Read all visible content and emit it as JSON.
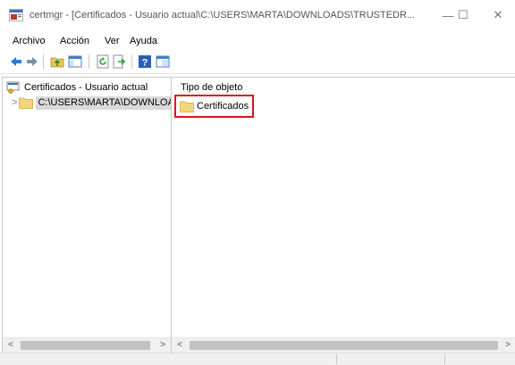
{
  "window": {
    "title": "certmgr - [Certificados - Usuario actual\\C:\\USERS\\MARTA\\DOWNLOADS\\TRUSTEDR...",
    "minimize": "—",
    "maximize": "☐",
    "close": "✕"
  },
  "menu": {
    "items": [
      "Archivo",
      "Acción",
      "Ver",
      "Ayuda"
    ]
  },
  "toolbar": {
    "icons": [
      "back-icon",
      "forward-icon",
      "up-folder-icon",
      "show-hide-tree-icon",
      "refresh-icon",
      "export-list-icon",
      "help-icon",
      "properties-icon"
    ]
  },
  "tree": {
    "root_label": "Certificados - Usuario actual",
    "child_label": "C:\\USERS\\MARTA\\DOWNLOADS\\TRUSTEDR",
    "child_chevron": ">"
  },
  "list": {
    "column_header": "Tipo de objeto",
    "items": [
      {
        "label": "Certificados",
        "icon": "folder-icon",
        "highlighted": true,
        "highlight_color": "#e0141b"
      }
    ]
  },
  "scroll": {
    "left_arrow": "<",
    "right_arrow": ">"
  },
  "colors": {
    "folder": "#f5d57a",
    "selection": "#d9d9d9",
    "highlight": "#e0141b",
    "nav_arrow": "#2b79d8"
  }
}
